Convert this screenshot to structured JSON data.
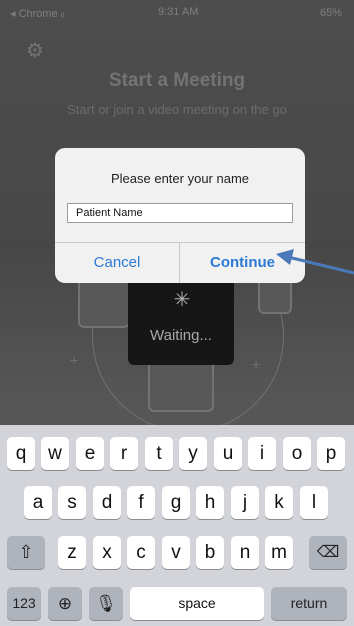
{
  "status_bar": {
    "carrier": "◂ Chrome ᵢₗ",
    "time": "9:31 AM",
    "battery": "65%"
  },
  "page": {
    "title": "Start a Meeting",
    "subtitle": "Start or join a video meeting on the go"
  },
  "dialog": {
    "title": "Please enter your name",
    "input_value": "Patient Name",
    "cancel_label": "Cancel",
    "continue_label": "Continue"
  },
  "waiting": {
    "label": "Waiting..."
  },
  "keyboard": {
    "row1": [
      "q",
      "w",
      "e",
      "r",
      "t",
      "y",
      "u",
      "i",
      "o",
      "p"
    ],
    "row2": [
      "a",
      "s",
      "d",
      "f",
      "g",
      "h",
      "j",
      "k",
      "l"
    ],
    "row3": [
      "z",
      "x",
      "c",
      "v",
      "b",
      "n",
      "m"
    ],
    "numbers_label": "123",
    "space_label": "space",
    "return_label": "return"
  },
  "icons": {
    "settings": "gear-icon",
    "spinner": "spinner-icon",
    "shift": "shift-icon",
    "delete": "delete-icon",
    "globe": "globe-icon",
    "mic": "microphone-icon",
    "annotation_arrow": "arrow-icon"
  },
  "colors": {
    "accent": "#2b7ad6",
    "arrow": "#4a78b8",
    "keyboard_bg": "#d2d4d9",
    "special_key": "#aeb3bc"
  }
}
